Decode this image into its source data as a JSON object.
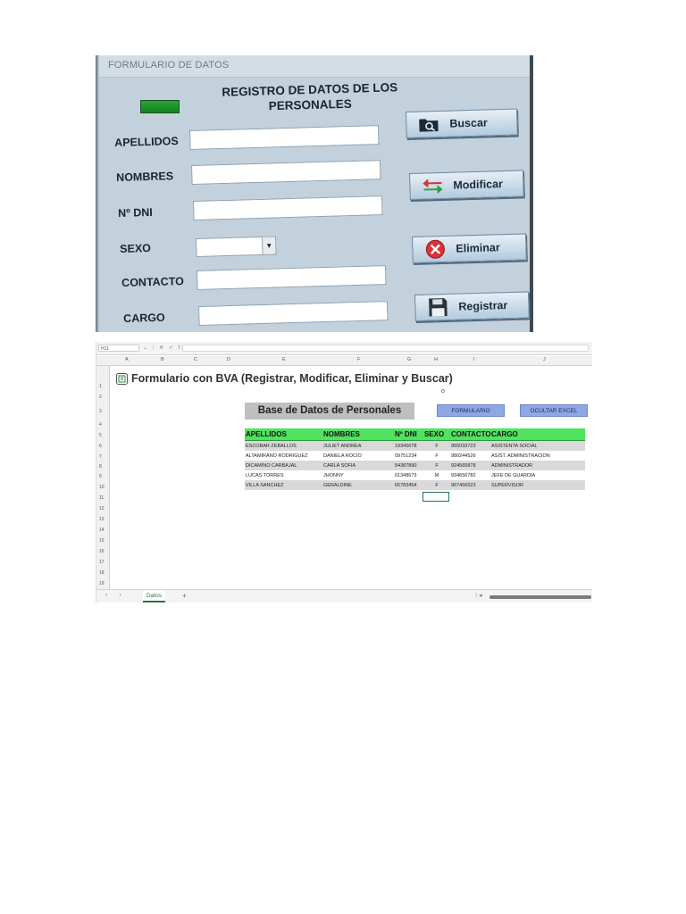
{
  "form": {
    "window_title": "FORMULARIO DE DATOS",
    "heading_line1": "REGISTRO DE DATOS DE LOS",
    "heading_line2": "PERSONALES",
    "labels": {
      "apellidos": "APELLIDOS",
      "nombres": "NOMBRES",
      "dni": "Nº DNI",
      "sexo": "SEXO",
      "contacto": "CONTACTO",
      "cargo": "CARGO"
    },
    "buttons": {
      "buscar": "Buscar",
      "modificar": "Modificar",
      "eliminar": "Eliminar",
      "registrar": "Registrar"
    },
    "indicator_color": "#1b9a2b",
    "icons": [
      "search-folder-icon",
      "swap-arrows-icon",
      "delete-x-icon",
      "save-disk-icon"
    ]
  },
  "excel": {
    "name_box": "H11",
    "formula_icons": "⌄ ⁝ ✕ ✓ fx",
    "columns": [
      "A",
      "B",
      "C",
      "D",
      "E",
      "F",
      "G",
      "H",
      "I",
      "J"
    ],
    "rows": [
      "1",
      "2",
      "3",
      "4",
      "5",
      "6",
      "7",
      "8",
      "9",
      "10",
      "11",
      "12",
      "13",
      "14",
      "15",
      "16",
      "17",
      "18",
      "19"
    ],
    "sheet_title": "Formulario con BVA (Registrar, Modificar, Eliminar y Buscar)",
    "small_mark": "o",
    "db_title": "Base de Datos de Personales",
    "btn_formulario": "FORMULARIO",
    "btn_ocultar": "OCULTAR EXCEL",
    "table_headers": [
      "APELLIDOS",
      "NOMBRES",
      "Nº DNI",
      "SEXO",
      "CONTACTO",
      "CARGO"
    ],
    "table_rows": [
      [
        "ESCOBAR ZEBALLOS",
        "JULIET ANDREA",
        "19345678",
        "F",
        "955033723",
        "ASISTENTA SOCIAL"
      ],
      [
        "ALTAMIRANO RODRIGUEZ",
        "DANIELA ROCIO",
        "09751234",
        "F",
        "980244526",
        "ASIST. ADMINISTRACION"
      ],
      [
        "DICAMINO CARBAJAL",
        "CARLA SOFIA",
        "54387890",
        "F",
        "924565878",
        "ADMINISTRADOR"
      ],
      [
        "LUCAS TORRES",
        "JHONNY",
        "01348673",
        "M",
        "934656782",
        "JEFE DE GUARDIA"
      ],
      [
        "VILLA SANCHEZ",
        "GERALDINE",
        "65783454",
        "F",
        "967456523",
        "SUPERVISOR"
      ]
    ],
    "sheet_tab": "Datos",
    "add_sheet": "+",
    "tab_nav": "‹ ›",
    "tab_dots": "⁝ ◂",
    "header_color": "#4fe35f"
  }
}
